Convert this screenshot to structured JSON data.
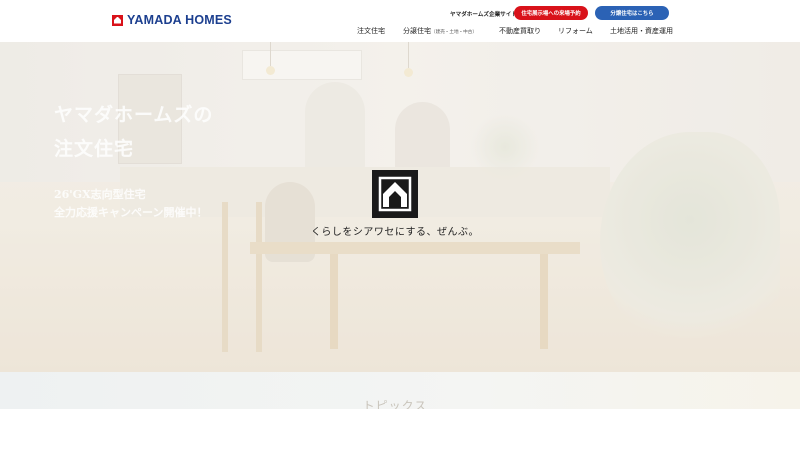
{
  "header": {
    "logo_text": "YAMADA HOMES",
    "corporate_link": "ヤマダホームズ企業サイト",
    "showroom_button": "住宅展示場への来場予約",
    "subdivision_button": "分譲住宅はこちら"
  },
  "nav": {
    "items": [
      {
        "label": "注文住宅",
        "sub": ""
      },
      {
        "label": "分譲住宅",
        "sub": "（建売・土地・中古）"
      },
      {
        "label": "不動産買取り",
        "sub": ""
      },
      {
        "label": "リフォーム",
        "sub": ""
      },
      {
        "label": "土地活用・資産運用",
        "sub": ""
      }
    ]
  },
  "hero": {
    "title_line1": "ヤマダホームズの",
    "title_line2": "注文住宅",
    "campaign_line1": "26'GX志向型住宅",
    "campaign_line2": "全力応援キャンペーン開催中！",
    "tagline": "くらしをシアワセにする、ぜんぶ。"
  },
  "topics": {
    "heading": "トピックス"
  },
  "colors": {
    "brand_blue": "#1c3f8f",
    "brand_red": "#d9121a",
    "button_blue": "#2b62b5"
  }
}
